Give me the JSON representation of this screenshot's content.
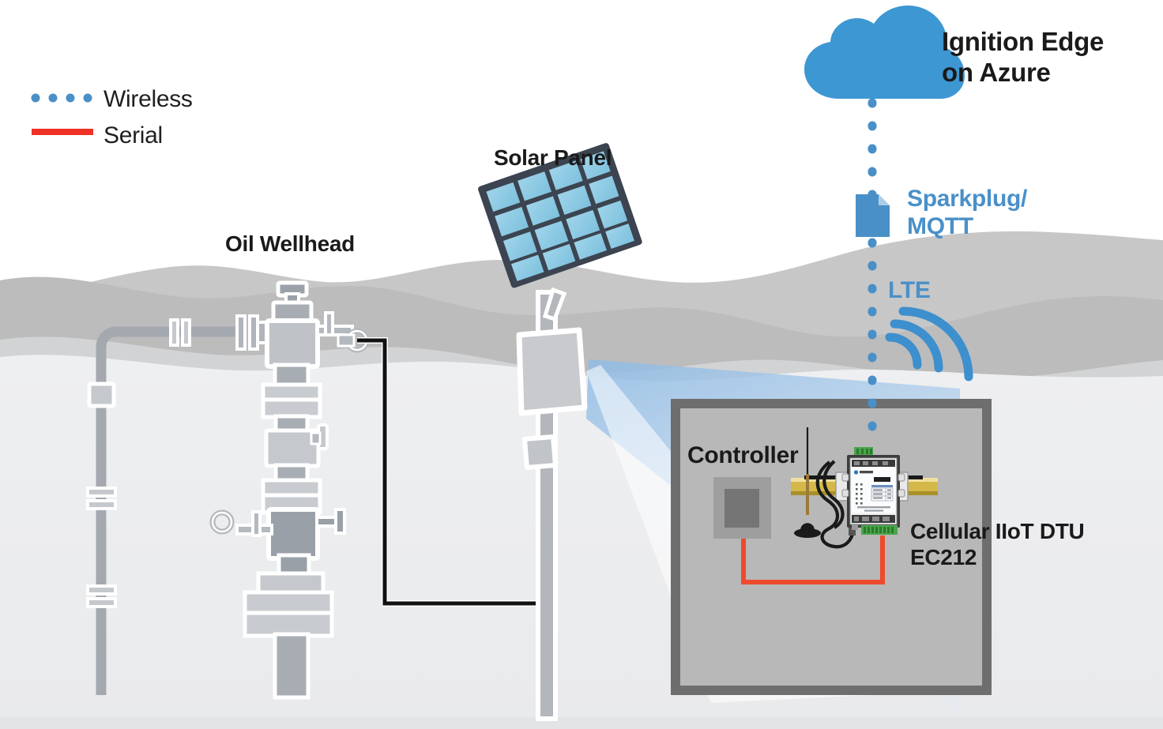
{
  "diagram": {
    "title_visible": false,
    "type": "iiot-architecture-diagram",
    "legend": {
      "items": [
        {
          "id": "wireless",
          "label": "Wireless",
          "style": "dotted",
          "color": "#4a90c8",
          "icon": "dotted-line-icon"
        },
        {
          "id": "serial",
          "label": "Serial",
          "style": "solid",
          "color": "#ee3124",
          "icon": "solid-line-icon"
        }
      ]
    },
    "nodes": {
      "cloud": {
        "label": "Ignition Edge\non Azure",
        "icon": "cloud-icon",
        "color": "#3d97d3"
      },
      "protocol": {
        "label": "Sparkplug/\nMQTT",
        "icon": "file-document-icon",
        "color": "#4a90c8"
      },
      "network": {
        "label": "LTE",
        "icon": "signal-waves-icon",
        "color": "#4a90c8"
      },
      "solar_panel": {
        "label": "Solar Panel",
        "icon": "solar-panel-icon",
        "cell_color": "#8ecae6",
        "frame_color": "#3b4450",
        "grid_rows": 4,
        "grid_cols": 4
      },
      "oil_wellhead": {
        "label": "Oil Wellhead",
        "icon": "wellhead-icon",
        "color": "#a9aeb5"
      },
      "controller": {
        "label": "Controller",
        "icon": "controller-box-icon",
        "color": "#9e9e9e"
      },
      "dtu": {
        "label": "Cellular IIoT DTU\nEC212",
        "icon": "dtu-device-icon",
        "model": "EC212",
        "brand": "ELANTEL",
        "faceplate_footer": "www.elantel.com"
      },
      "cabinet": {
        "icon": "enclosure-cabinet-icon",
        "border_color": "#6e6e6e",
        "fill_color": "#b8b8b8"
      },
      "pole_enclosure": {
        "icon": "pole-enclosure-icon",
        "color": "#c9cacd"
      }
    },
    "links": [
      {
        "id": "cloud-to-dtu",
        "from": "cloud",
        "to": "dtu",
        "type": "wireless",
        "label": "Sparkplug/MQTT over LTE",
        "color": "#4a90c8"
      },
      {
        "id": "controller-to-dtu",
        "from": "controller",
        "to": "dtu",
        "type": "serial",
        "label": "Serial",
        "color": "#ee3124"
      },
      {
        "id": "wellhead-to-pole",
        "from": "oil_wellhead",
        "to": "pole_enclosure",
        "type": "cable",
        "label": "",
        "color": "#111111"
      }
    ],
    "palette": {
      "sky": "#ffffff",
      "hill_far": "#c9c9c9",
      "hill_mid": "#bdbdbd",
      "hill_near": "#d4d4d4",
      "ground": "#ebecee",
      "accent_blue": "#3d97d3",
      "accent_light_blue": "#4a90c8",
      "accent_red": "#ee3124",
      "cone_blue": "#a8c9e8"
    }
  }
}
